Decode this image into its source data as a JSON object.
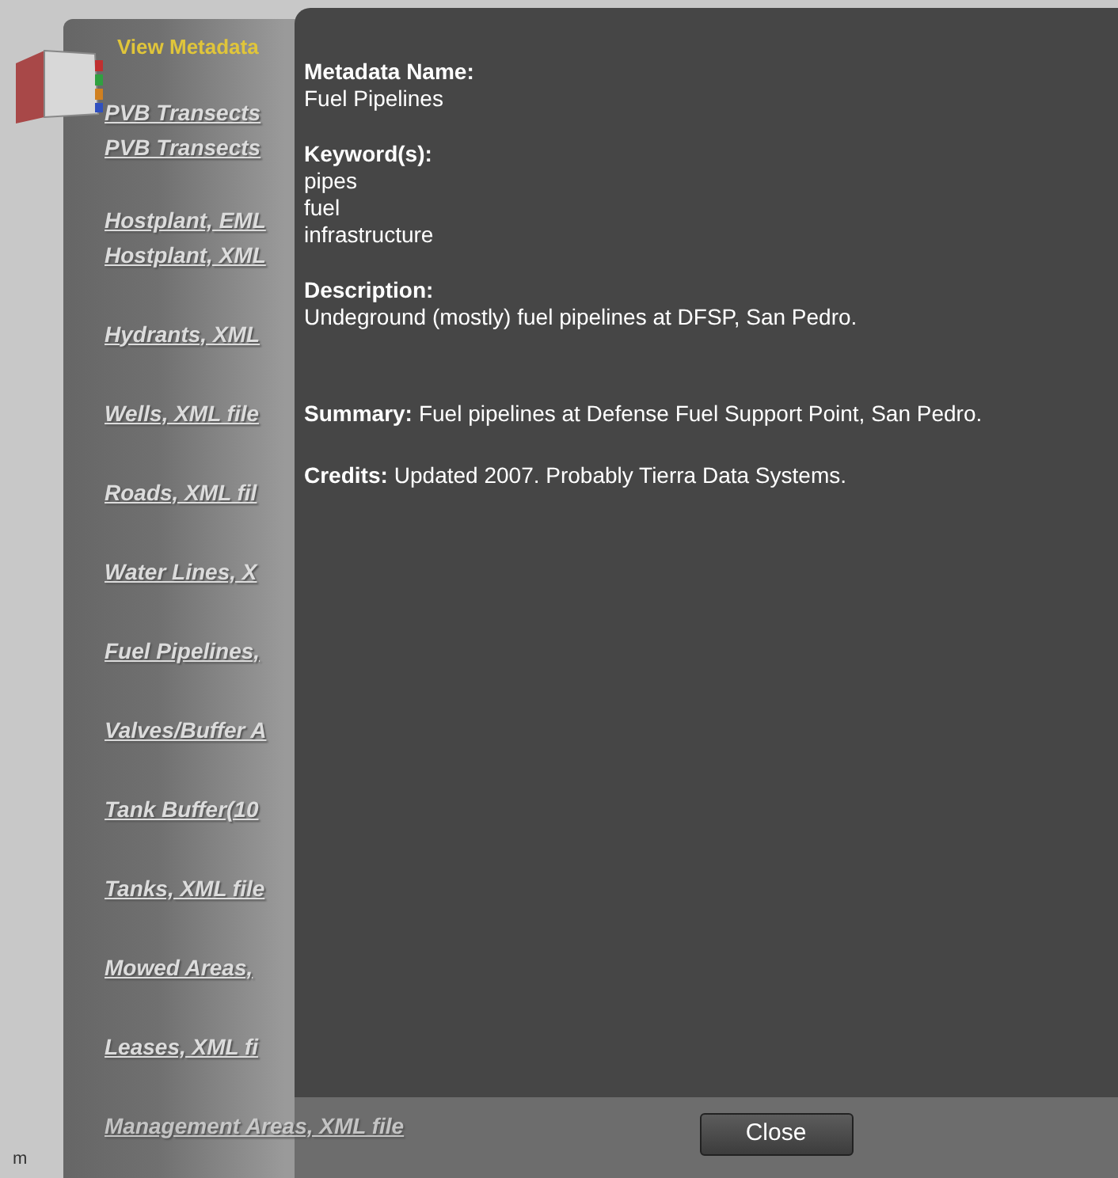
{
  "panel": {
    "title": "View Metadata",
    "link_groups": [
      [
        "PVB Transects",
        "PVB Transects"
      ],
      [
        "Hostplant, EML",
        "Hostplant, XML"
      ],
      [
        "Hydrants, XML"
      ],
      [
        "Wells, XML file"
      ],
      [
        "Roads, XML fil"
      ],
      [
        "Water Lines, X"
      ],
      [
        "Fuel Pipelines,"
      ],
      [
        "Valves/Buffer A"
      ],
      [
        "Tank Buffer(10"
      ],
      [
        "Tanks, XML file"
      ],
      [
        "Mowed Areas,"
      ],
      [
        "Leases, XML fi"
      ],
      [
        "Management Areas, XML file"
      ]
    ],
    "side_text": "m"
  },
  "dialog": {
    "sections": [
      {
        "kind": "block",
        "label": "Metadata Name:",
        "lines": [
          "Fuel Pipelines"
        ]
      },
      {
        "kind": "block",
        "label": "Keyword(s):",
        "lines": [
          "pipes",
          "fuel",
          "infrastructure"
        ]
      },
      {
        "kind": "block",
        "label": "Description:",
        "lines": [
          "Undeground (mostly) fuel pipelines at DFSP, San Pedro."
        ]
      },
      {
        "kind": "inline",
        "label": "Summary:",
        "text": "Fuel pipelines at Defense Fuel Support Point, San Pedro."
      },
      {
        "kind": "inline",
        "label": "Credits:",
        "text": "Updated 2007. Probably Tierra Data Systems."
      }
    ],
    "close_button": "Close"
  }
}
